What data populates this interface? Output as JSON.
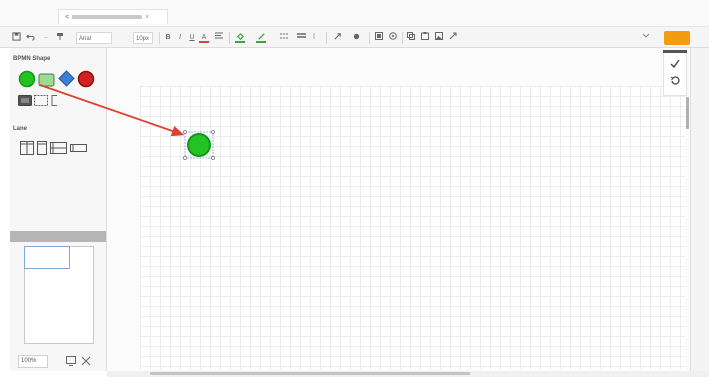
{
  "tabs": [
    {
      "label": ""
    },
    {
      "label": "",
      "close": "×"
    }
  ],
  "toolbar": {
    "font_name": "Arial",
    "font_size": "10px",
    "bold": "B",
    "italic": "I",
    "underline": "U",
    "font_color_letter": "A",
    "fill_color": "#3aa63a",
    "line_color": "#3aa63a",
    "font_color": "#e04040",
    "edit_label": ""
  },
  "left_panel": {
    "bpmn_header": "BPMN Shape",
    "lane_header": "Lane",
    "outline_header": "",
    "zoom_value": "100%"
  },
  "canvas": {
    "node_label": ""
  },
  "colors": {
    "start_event": "#22c322",
    "start_event_border": "#15961a",
    "task": "#9fd99a",
    "gateway": "#3c7fd8",
    "end_event": "#d22121",
    "arrow": "#e04030",
    "accent": "#f39c12"
  }
}
